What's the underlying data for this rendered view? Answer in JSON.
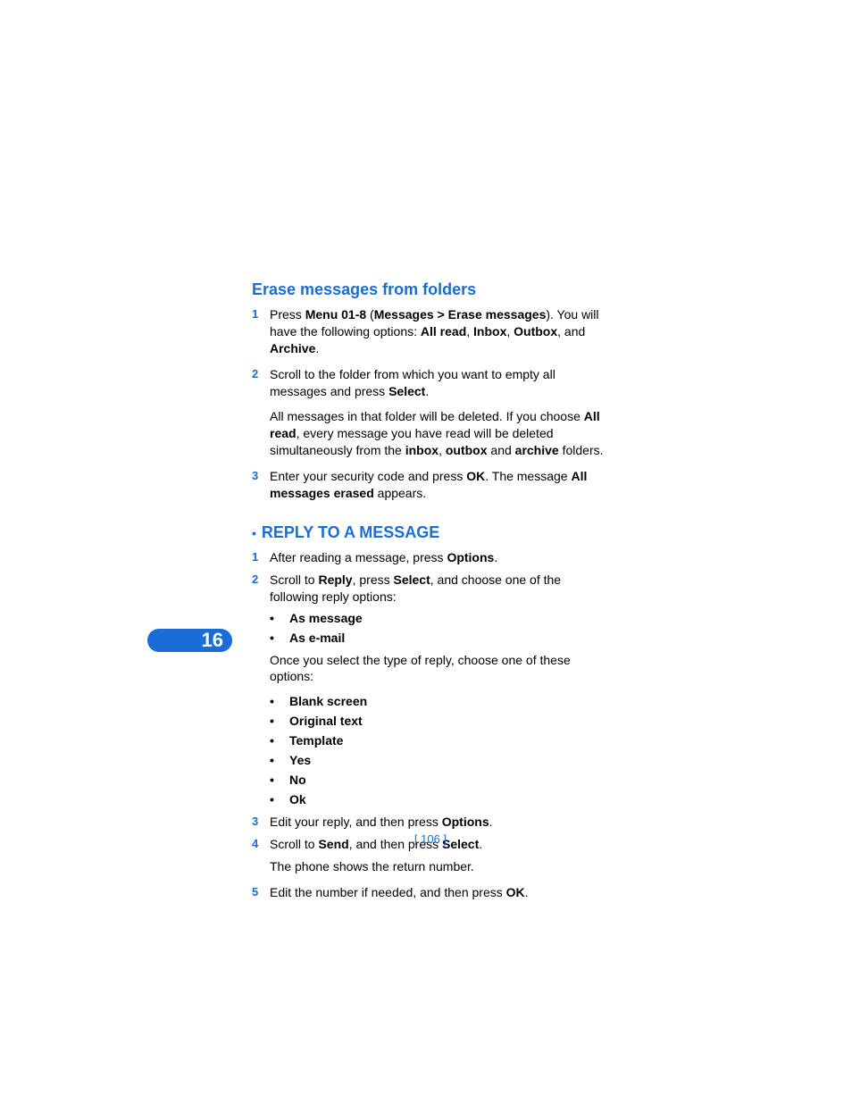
{
  "chapter_number": "16",
  "page_number": "[ 106 ]",
  "section1": {
    "heading": "Erase messages from folders",
    "items": [
      {
        "num": "1",
        "html": "Press <b>Menu 01-8</b> (<b>Messages > Erase messages</b>). You will have the following options: <b>All read</b>, <b>Inbox</b>, <b>Outbox</b>, and <b>Archive</b>."
      },
      {
        "num": "2",
        "html": "Scroll to the folder from which you want to empty all messages and press <b>Select</b>.",
        "after": "All messages in that folder will be deleted. If you choose <b>All read</b>, every message you have read will be deleted simultaneously from the <b>inbox</b>, <b>outbox</b> and <b>archive</b> folders."
      },
      {
        "num": "3",
        "html": "Enter your security code and press <b>OK</b>. The message <b>All messages erased</b> appears."
      }
    ]
  },
  "section2": {
    "heading": "REPLY TO A MESSAGE",
    "items": [
      {
        "num": "1",
        "html": "After reading a message, press <b>Options</b>."
      },
      {
        "num": "2",
        "html": "Scroll to <b>Reply</b>, press <b>Select</b>, and choose one of the following reply options:",
        "bullets1": [
          "As message",
          "As e-mail"
        ],
        "mid_text": "Once you select the type of reply, choose one of these options:",
        "bullets2": [
          "Blank screen",
          "Original text",
          "Template",
          "Yes",
          "No",
          "Ok"
        ]
      },
      {
        "num": "3",
        "html": "Edit your reply, and then press <b>Options</b>."
      },
      {
        "num": "4",
        "html": "Scroll to <b>Send</b>, and then press <b>Select</b>.",
        "after_plain": "The phone shows the return number."
      },
      {
        "num": "5",
        "html": "Edit the number if needed, and then press <b>OK</b>."
      }
    ]
  }
}
